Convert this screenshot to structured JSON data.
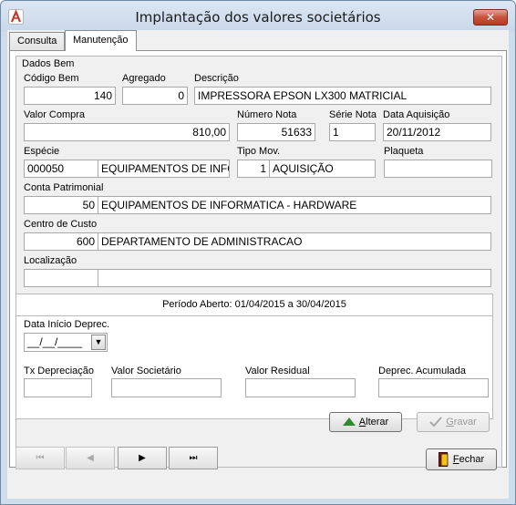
{
  "window": {
    "title": "Implantação dos valores societários",
    "close_glyph": "✕"
  },
  "tabs": [
    {
      "label": "Consulta",
      "active": false
    },
    {
      "label": "Manutenção",
      "active": true
    }
  ],
  "dados_bem": {
    "group_title": "Dados Bem",
    "codigo_bem": {
      "label": "Código Bem",
      "value": "140"
    },
    "agregado": {
      "label": "Agregado",
      "value": "0"
    },
    "descricao": {
      "label": "Descrição",
      "value": "IMPRESSORA EPSON LX300 MATRICIAL"
    },
    "valor_compra": {
      "label": "Valor Compra",
      "value": "810,00"
    },
    "numero_nota": {
      "label": "Número Nota",
      "value": "51633"
    },
    "serie_nota": {
      "label": "Série Nota",
      "value": "1"
    },
    "data_aquisicao": {
      "label": "Data Aquisição",
      "value": "20/11/2012"
    },
    "especie": {
      "label": "Espécie",
      "code": "000050",
      "desc": "EQUIPAMENTOS DE INFOR"
    },
    "tipo_mov": {
      "label": "Tipo Mov.",
      "code": "1",
      "desc": "AQUISIÇÃO"
    },
    "plaqueta": {
      "label": "Plaqueta",
      "value": ""
    },
    "conta_patrimonial": {
      "label": "Conta Patrimonial",
      "code": "50",
      "desc": "EQUIPAMENTOS DE INFORMATICA - HARDWARE"
    },
    "centro_custo": {
      "label": "Centro de Custo",
      "code": "600",
      "desc": "DEPARTAMENTO DE ADMINISTRACAO"
    },
    "localizacao": {
      "label": "Localização",
      "code": "",
      "desc": ""
    }
  },
  "periodo": {
    "title": "Período Aberto: 01/04/2015 a 30/04/2015",
    "data_inicio": {
      "label": "Data Início Deprec.",
      "value": "__/__/____"
    },
    "tx_depreciacao": {
      "label": "Tx Depreciação",
      "value": ""
    },
    "valor_societario": {
      "label": "Valor Societário",
      "value": ""
    },
    "valor_residual": {
      "label": "Valor Residual",
      "value": ""
    },
    "deprec_acumulada": {
      "label": "Deprec. Acumulada",
      "value": ""
    },
    "alterar_button": {
      "label_first": "A",
      "label_rest": "lterar"
    },
    "gravar_button": {
      "label_first": "G",
      "label_rest": "ravar"
    }
  },
  "navigation": {
    "first_glyph": "⏮",
    "prev_glyph": "◀",
    "next_glyph": "▶",
    "last_glyph": "⏭"
  },
  "fechar_button": {
    "label_first": "F",
    "label_rest": "echar"
  },
  "colors": {
    "title_bar": "#cfdcea",
    "close_button": "#c8523c",
    "alterar_icon": "#2e8b2e"
  }
}
